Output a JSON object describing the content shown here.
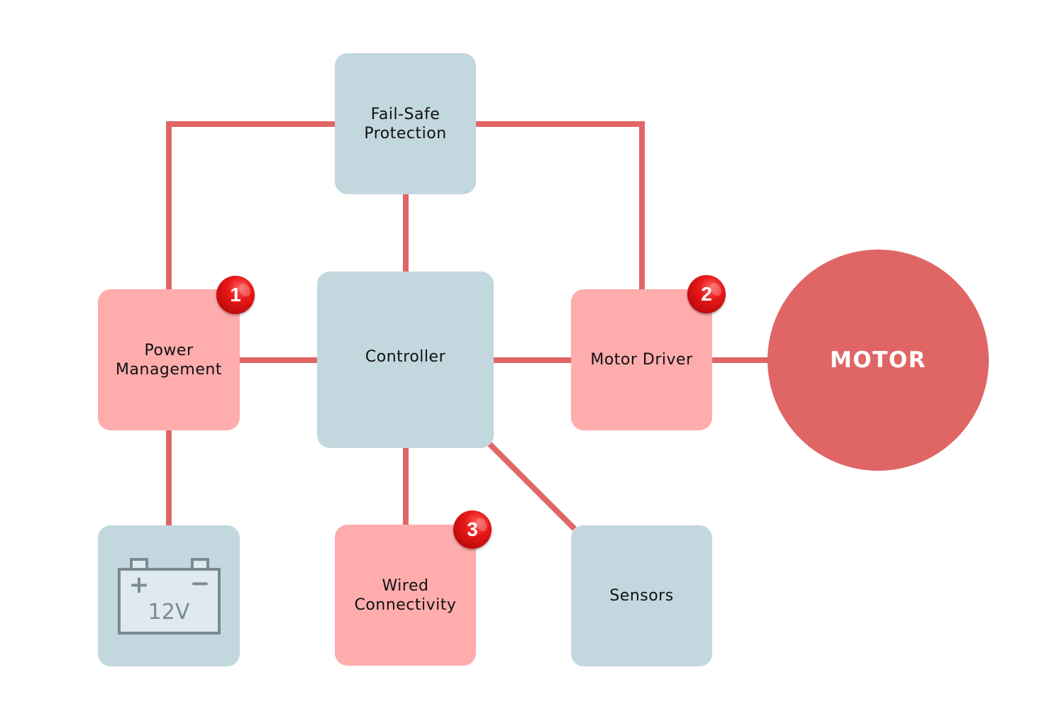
{
  "diagram": {
    "title": "",
    "colors": {
      "wire": "#e06666",
      "block_neutral": "#c2d7de",
      "block_highlight": "#ffacad",
      "motor": "#e06666",
      "badge": "#d81010",
      "battery_stroke": "#7a8a90",
      "battery_fill": "#deeaf0"
    },
    "blocks": {
      "failsafe": {
        "label": "Fail-Safe\nProtection"
      },
      "power": {
        "label": "Power\nManagement",
        "badge": "1"
      },
      "controller": {
        "label": "Controller"
      },
      "motor_driver": {
        "label": "Motor Driver",
        "badge": "2"
      },
      "motor": {
        "label": "MOTOR"
      },
      "battery": {
        "label": "12V",
        "plus": "+",
        "minus": "−",
        "icon": "battery-icon"
      },
      "wired": {
        "label": "Wired\nConnectivity",
        "badge": "3"
      },
      "sensors": {
        "label": "Sensors"
      }
    },
    "connections": [
      {
        "from": "power",
        "to": "failsafe"
      },
      {
        "from": "failsafe",
        "to": "motor_driver"
      },
      {
        "from": "failsafe",
        "to": "controller"
      },
      {
        "from": "power",
        "to": "controller"
      },
      {
        "from": "controller",
        "to": "motor_driver"
      },
      {
        "from": "motor_driver",
        "to": "motor"
      },
      {
        "from": "power",
        "to": "battery"
      },
      {
        "from": "controller",
        "to": "wired"
      },
      {
        "from": "controller",
        "to": "sensors"
      }
    ]
  }
}
